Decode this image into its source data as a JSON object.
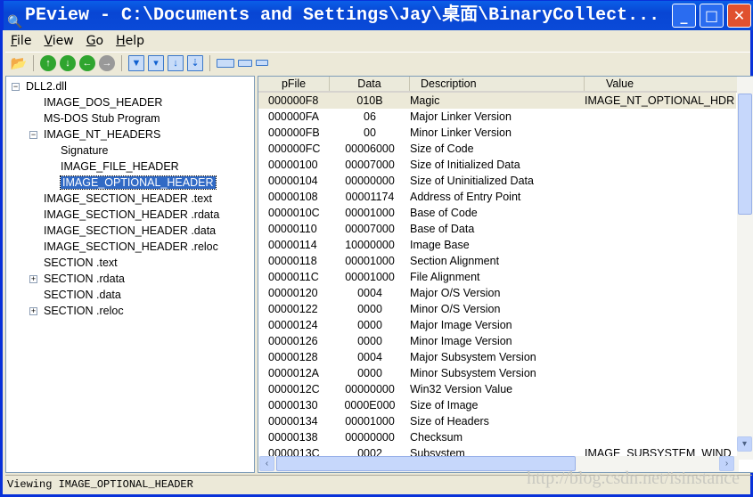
{
  "window": {
    "title": "PEview - C:\\Documents and Settings\\Jay\\桌面\\BinaryCollect...",
    "minimize": "_",
    "maximize": "□",
    "close": "✕"
  },
  "menu": [
    {
      "key": "F",
      "rest": "ile"
    },
    {
      "key": "V",
      "rest": "iew"
    },
    {
      "key": "G",
      "rest": "o"
    },
    {
      "key": "H",
      "rest": "elp"
    }
  ],
  "tree": [
    {
      "label": "DLL2.dll",
      "level": 0,
      "toggle": "−"
    },
    {
      "label": "IMAGE_DOS_HEADER",
      "level": 1
    },
    {
      "label": "MS-DOS Stub Program",
      "level": 1
    },
    {
      "label": "IMAGE_NT_HEADERS",
      "level": 1,
      "toggle": "−"
    },
    {
      "label": "Signature",
      "level": 2
    },
    {
      "label": "IMAGE_FILE_HEADER",
      "level": 2
    },
    {
      "label": "IMAGE_OPTIONAL_HEADER",
      "level": 2,
      "selected": true
    },
    {
      "label": "IMAGE_SECTION_HEADER .text",
      "level": 1
    },
    {
      "label": "IMAGE_SECTION_HEADER .rdata",
      "level": 1
    },
    {
      "label": "IMAGE_SECTION_HEADER .data",
      "level": 1
    },
    {
      "label": "IMAGE_SECTION_HEADER .reloc",
      "level": 1
    },
    {
      "label": "SECTION .text",
      "level": 1
    },
    {
      "label": "SECTION .rdata",
      "level": 1,
      "toggle": "+"
    },
    {
      "label": "SECTION .data",
      "level": 1
    },
    {
      "label": "SECTION .reloc",
      "level": 1,
      "toggle": "+"
    }
  ],
  "columns": [
    "pFile",
    "Data",
    "Description",
    "Value"
  ],
  "rows": [
    [
      "000000F8",
      "010B",
      "Magic",
      "IMAGE_NT_OPTIONAL_HDR"
    ],
    [
      "000000FA",
      "06",
      "Major Linker Version",
      ""
    ],
    [
      "000000FB",
      "00",
      "Minor Linker Version",
      ""
    ],
    [
      "000000FC",
      "00006000",
      "Size of Code",
      ""
    ],
    [
      "00000100",
      "00007000",
      "Size of Initialized Data",
      ""
    ],
    [
      "00000104",
      "00000000",
      "Size of Uninitialized Data",
      ""
    ],
    [
      "00000108",
      "00001174",
      "Address of Entry Point",
      ""
    ],
    [
      "0000010C",
      "00001000",
      "Base of Code",
      ""
    ],
    [
      "00000110",
      "00007000",
      "Base of Data",
      ""
    ],
    [
      "00000114",
      "10000000",
      "Image Base",
      ""
    ],
    [
      "00000118",
      "00001000",
      "Section Alignment",
      ""
    ],
    [
      "0000011C",
      "00001000",
      "File Alignment",
      ""
    ],
    [
      "00000120",
      "0004",
      "Major O/S Version",
      ""
    ],
    [
      "00000122",
      "0000",
      "Minor O/S Version",
      ""
    ],
    [
      "00000124",
      "0000",
      "Major Image Version",
      ""
    ],
    [
      "00000126",
      "0000",
      "Minor Image Version",
      ""
    ],
    [
      "00000128",
      "0004",
      "Major Subsystem Version",
      ""
    ],
    [
      "0000012A",
      "0000",
      "Minor Subsystem Version",
      ""
    ],
    [
      "0000012C",
      "00000000",
      "Win32 Version Value",
      ""
    ],
    [
      "00000130",
      "0000E000",
      "Size of Image",
      ""
    ],
    [
      "00000134",
      "00001000",
      "Size of Headers",
      ""
    ],
    [
      "00000138",
      "00000000",
      "Checksum",
      ""
    ],
    [
      "0000013C",
      "0002",
      "Subsystem",
      "IMAGE_SUBSYSTEM_WIND"
    ]
  ],
  "status": "Viewing IMAGE_OPTIONAL_HEADER",
  "watermark": "http://blog.csdn.net/isinstance"
}
